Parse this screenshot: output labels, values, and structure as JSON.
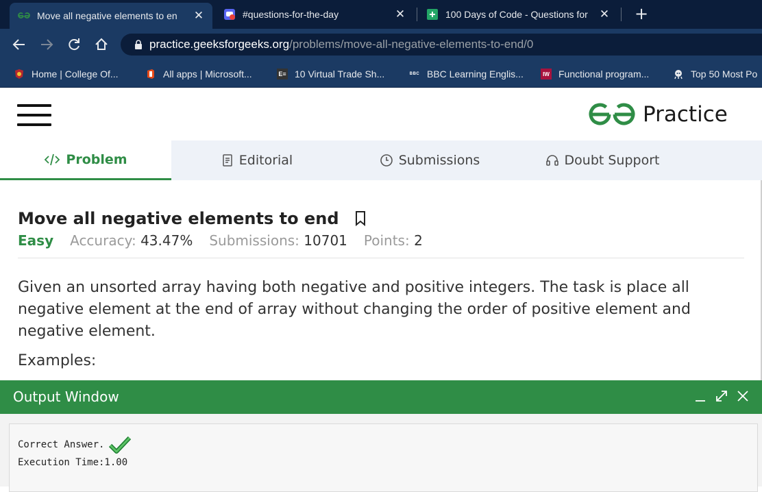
{
  "browser": {
    "tabs": [
      {
        "title": "Move all negative elements to en",
        "active": true,
        "favicon": "gfg-icon"
      },
      {
        "title": "#questions-for-the-day",
        "active": false,
        "favicon": "discord-icon"
      },
      {
        "title": "100 Days of Code - Questions for",
        "active": false,
        "favicon": "sheets-icon"
      }
    ],
    "url_host": "practice.geeksforgeeks.org",
    "url_path": "/problems/move-all-negative-elements-to-end/0",
    "bookmarks": [
      {
        "label": "Home | College Of...",
        "icon": "college-icon"
      },
      {
        "label": "All apps | Microsoft...",
        "icon": "office-icon"
      },
      {
        "label": "10 Virtual Trade Sh...",
        "icon": "e-icon"
      },
      {
        "label": "BBC Learning Englis...",
        "icon": "bbc-icon"
      },
      {
        "label": "Functional program...",
        "icon": "iw-icon"
      },
      {
        "label": "Top 50 Most Po",
        "icon": "octocat-icon"
      }
    ]
  },
  "site": {
    "logo_text": "Practice",
    "brand_color": "#2f8d46"
  },
  "problem_tabs": [
    {
      "label": "Problem",
      "icon": "code-icon",
      "active": true
    },
    {
      "label": "Editorial",
      "icon": "document-icon",
      "active": false
    },
    {
      "label": "Submissions",
      "icon": "clock-icon",
      "active": false
    },
    {
      "label": "Doubt Support",
      "icon": "headset-icon",
      "active": false
    }
  ],
  "problem": {
    "title": "Move all negative elements to end",
    "difficulty": "Easy",
    "accuracy_label": "Accuracy:",
    "accuracy": "43.47%",
    "submissions_label": "Submissions:",
    "submissions": "10701",
    "points_label": "Points:",
    "points": "2",
    "description": "Given an unsorted array having both negative and positive integers. The task is place all negative element at the end of array without changing the order of positive element and negative element.",
    "examples_label": "Examples:"
  },
  "output_window": {
    "title": "Output Window",
    "result": "Correct Answer.",
    "execution_time": "Execution Time:1.00"
  }
}
